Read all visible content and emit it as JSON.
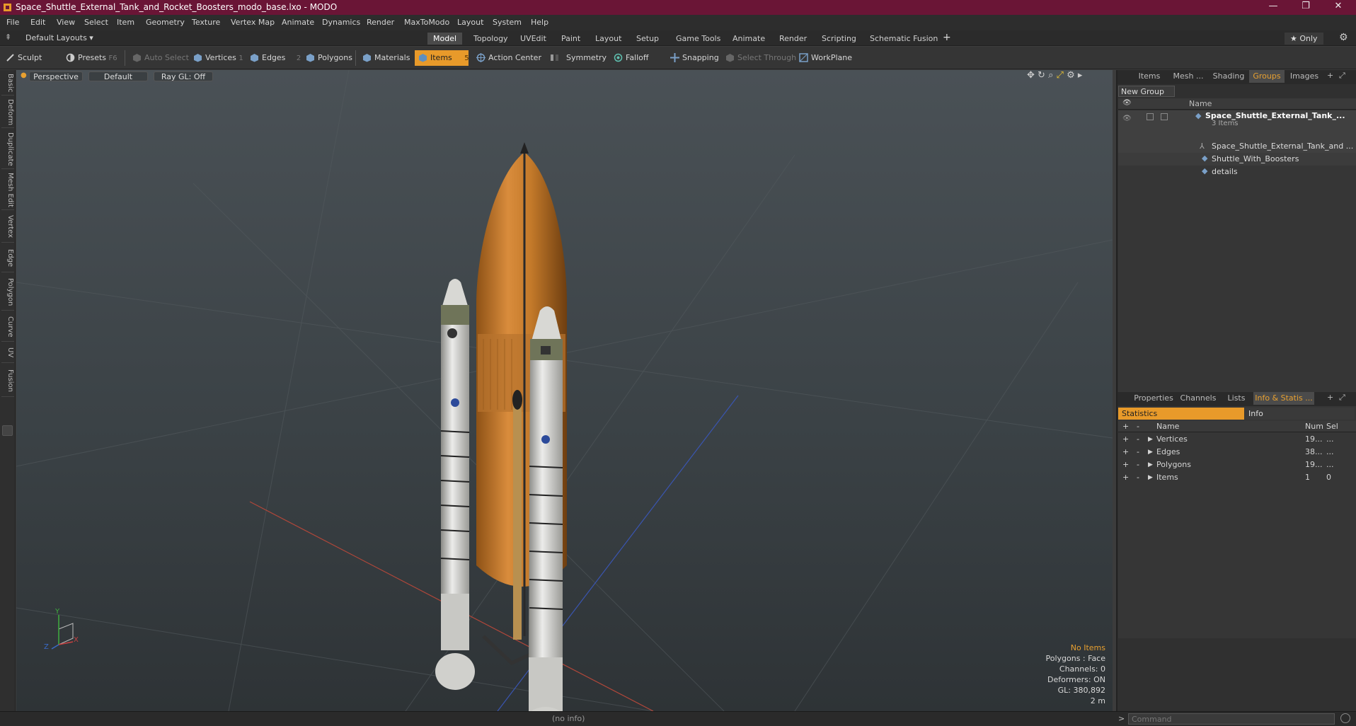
{
  "window": {
    "title": "Space_Shuttle_External_Tank_and_Rocket_Boosters_modo_base.lxo - MODO",
    "minimize": "—",
    "restore": "❐",
    "close": "✕"
  },
  "menu": [
    "File",
    "Edit",
    "View",
    "Select",
    "Item",
    "Geometry",
    "Texture",
    "Vertex Map",
    "Animate",
    "Dynamics",
    "Render",
    "MaxToModo",
    "Layout",
    "System",
    "Help"
  ],
  "layoutbar": {
    "layouts_label": "Default Layouts ▾",
    "tabs": [
      "Model",
      "Topology",
      "UVEdit",
      "Paint",
      "Layout",
      "Setup",
      "Game Tools",
      "Animate",
      "Render",
      "Scripting",
      "Schematic Fusion"
    ],
    "active_tab": "Model",
    "add": "+",
    "only": "★  Only",
    "gear": "⚙"
  },
  "toolbar": {
    "sculpt": "Sculpt",
    "presets": "Presets",
    "presets_key": "F6",
    "auto_select": "Auto Select",
    "vertices": "Vertices",
    "vertices_key": "1",
    "edges": "Edges",
    "edges_key": "2",
    "polygons": "Polygons",
    "materials": "Materials",
    "items": "Items",
    "items_key": "5",
    "action_center": "Action Center",
    "symmetry": "Symmetry",
    "falloff": "Falloff",
    "snapping": "Snapping",
    "select_through": "Select Through",
    "workplane": "WorkPlane"
  },
  "left_tabs": [
    "Basic",
    "Deform",
    "Duplicate",
    "Mesh Edit",
    "Vertex",
    "Edge",
    "Polygon",
    "Curve",
    "UV",
    "Fusion"
  ],
  "viewport": {
    "view": "Perspective",
    "shading": "Default",
    "raygl": "Ray GL: Off",
    "overlay": {
      "no_items": "No Items",
      "polygons": "Polygons : Face",
      "channels": "Channels: 0",
      "deformers": "Deformers: ON",
      "gl": "GL: 380,892",
      "scale": "2 m"
    },
    "axis_x": "X",
    "axis_y": "Y",
    "axis_z": "Z"
  },
  "groups_panel": {
    "tabs": [
      "Items",
      "Mesh ...",
      "Shading",
      "Groups",
      "Images"
    ],
    "active": "Groups",
    "new_group": "New Group",
    "col_name": "Name",
    "root": "Space_Shuttle_External_Tank_...",
    "root_count": "3 Items",
    "children": [
      "Space_Shuttle_External_Tank_and ...",
      "Shuttle_With_Boosters",
      "details"
    ]
  },
  "stats_panel": {
    "tabs": [
      "Properties",
      "Channels",
      "Lists",
      "Info & Statis ..."
    ],
    "active": "Info & Statis ...",
    "sub_tabs": [
      "Statistics",
      "Info"
    ],
    "columns": [
      "Name",
      "Num",
      "Sel"
    ],
    "rows": [
      {
        "name": "Vertices",
        "num": "19...",
        "sel": "..."
      },
      {
        "name": "Edges",
        "num": "38...",
        "sel": "..."
      },
      {
        "name": "Polygons",
        "num": "19...",
        "sel": "..."
      },
      {
        "name": "Items",
        "num": "1",
        "sel": "0"
      }
    ]
  },
  "status": {
    "info": "(no info)",
    "command_placeholder": "Command"
  },
  "colors": {
    "titlebar": "#6a1536",
    "accent": "#e89a2a",
    "tank": "#c97a2e",
    "booster": "#d8d8d4"
  }
}
